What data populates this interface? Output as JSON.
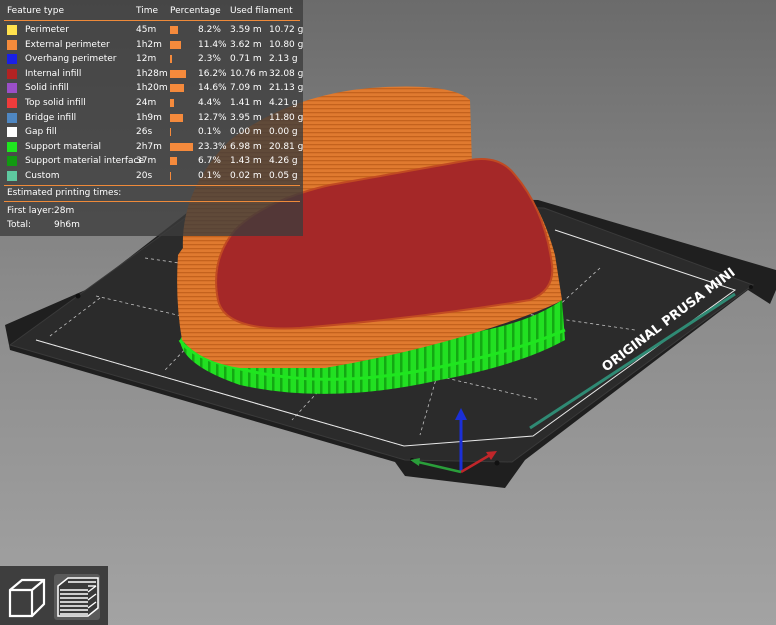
{
  "legend": {
    "headers": {
      "feature": "Feature type",
      "time": "Time",
      "percentage": "Percentage",
      "filament": "Used filament"
    },
    "rows": [
      {
        "name": "Perimeter",
        "color": "#ffe14d",
        "time": "45m",
        "pct": "8.2%",
        "pct_value": 8.2,
        "len": "3.59 m",
        "weight": "10.72 g"
      },
      {
        "name": "External perimeter",
        "color": "#f48a3b",
        "time": "1h2m",
        "pct": "11.4%",
        "pct_value": 11.4,
        "len": "3.62 m",
        "weight": "10.80 g"
      },
      {
        "name": "Overhang perimeter",
        "color": "#1a20e6",
        "time": "12m",
        "pct": "2.3%",
        "pct_value": 2.3,
        "len": "0.71 m",
        "weight": "2.13 g"
      },
      {
        "name": "Internal infill",
        "color": "#b22222",
        "time": "1h28m",
        "pct": "16.2%",
        "pct_value": 16.2,
        "len": "10.76 m",
        "weight": "32.08 g"
      },
      {
        "name": "Solid infill",
        "color": "#9b4fc8",
        "time": "1h20m",
        "pct": "14.6%",
        "pct_value": 14.6,
        "len": "7.09 m",
        "weight": "21.13 g"
      },
      {
        "name": "Top solid infill",
        "color": "#ef3b3b",
        "time": "24m",
        "pct": "4.4%",
        "pct_value": 4.4,
        "len": "1.41 m",
        "weight": "4.21 g"
      },
      {
        "name": "Bridge infill",
        "color": "#4f87c2",
        "time": "1h9m",
        "pct": "12.7%",
        "pct_value": 12.7,
        "len": "3.95 m",
        "weight": "11.80 g"
      },
      {
        "name": "Gap fill",
        "color": "#ffffff",
        "time": "26s",
        "pct": "0.1%",
        "pct_value": 0.1,
        "len": "0.00 m",
        "weight": "0.00 g"
      },
      {
        "name": "Support material",
        "color": "#1fe61f",
        "time": "2h7m",
        "pct": "23.3%",
        "pct_value": 23.3,
        "len": "6.98 m",
        "weight": "20.81 g"
      },
      {
        "name": "Support material interface",
        "color": "#119911",
        "time": "37m",
        "pct": "6.7%",
        "pct_value": 6.7,
        "len": "1.43 m",
        "weight": "4.26 g"
      },
      {
        "name": "Custom",
        "color": "#5ec9a0",
        "time": "20s",
        "pct": "0.1%",
        "pct_value": 0.1,
        "len": "0.02 m",
        "weight": "0.05 g"
      }
    ],
    "estimated_title": "Estimated printing times:",
    "first_layer_label": "First layer:",
    "first_layer_value": "28m",
    "total_label": "Total:",
    "total_value": "9h6m"
  },
  "bed": {
    "brand_text": "ORIGINAL PRUSA MINI"
  },
  "view_buttons": [
    {
      "name": "3d-view",
      "icon": "cube-icon"
    },
    {
      "name": "preview",
      "icon": "layers-icon"
    }
  ],
  "colors": {
    "panel_bg": "#3c3c3c",
    "accent": "#ee8a3a",
    "bed": "#2a2a2a",
    "support": "#1fe61f",
    "external_perimeter": "#f48a3b",
    "top_infill": "#b22222"
  }
}
